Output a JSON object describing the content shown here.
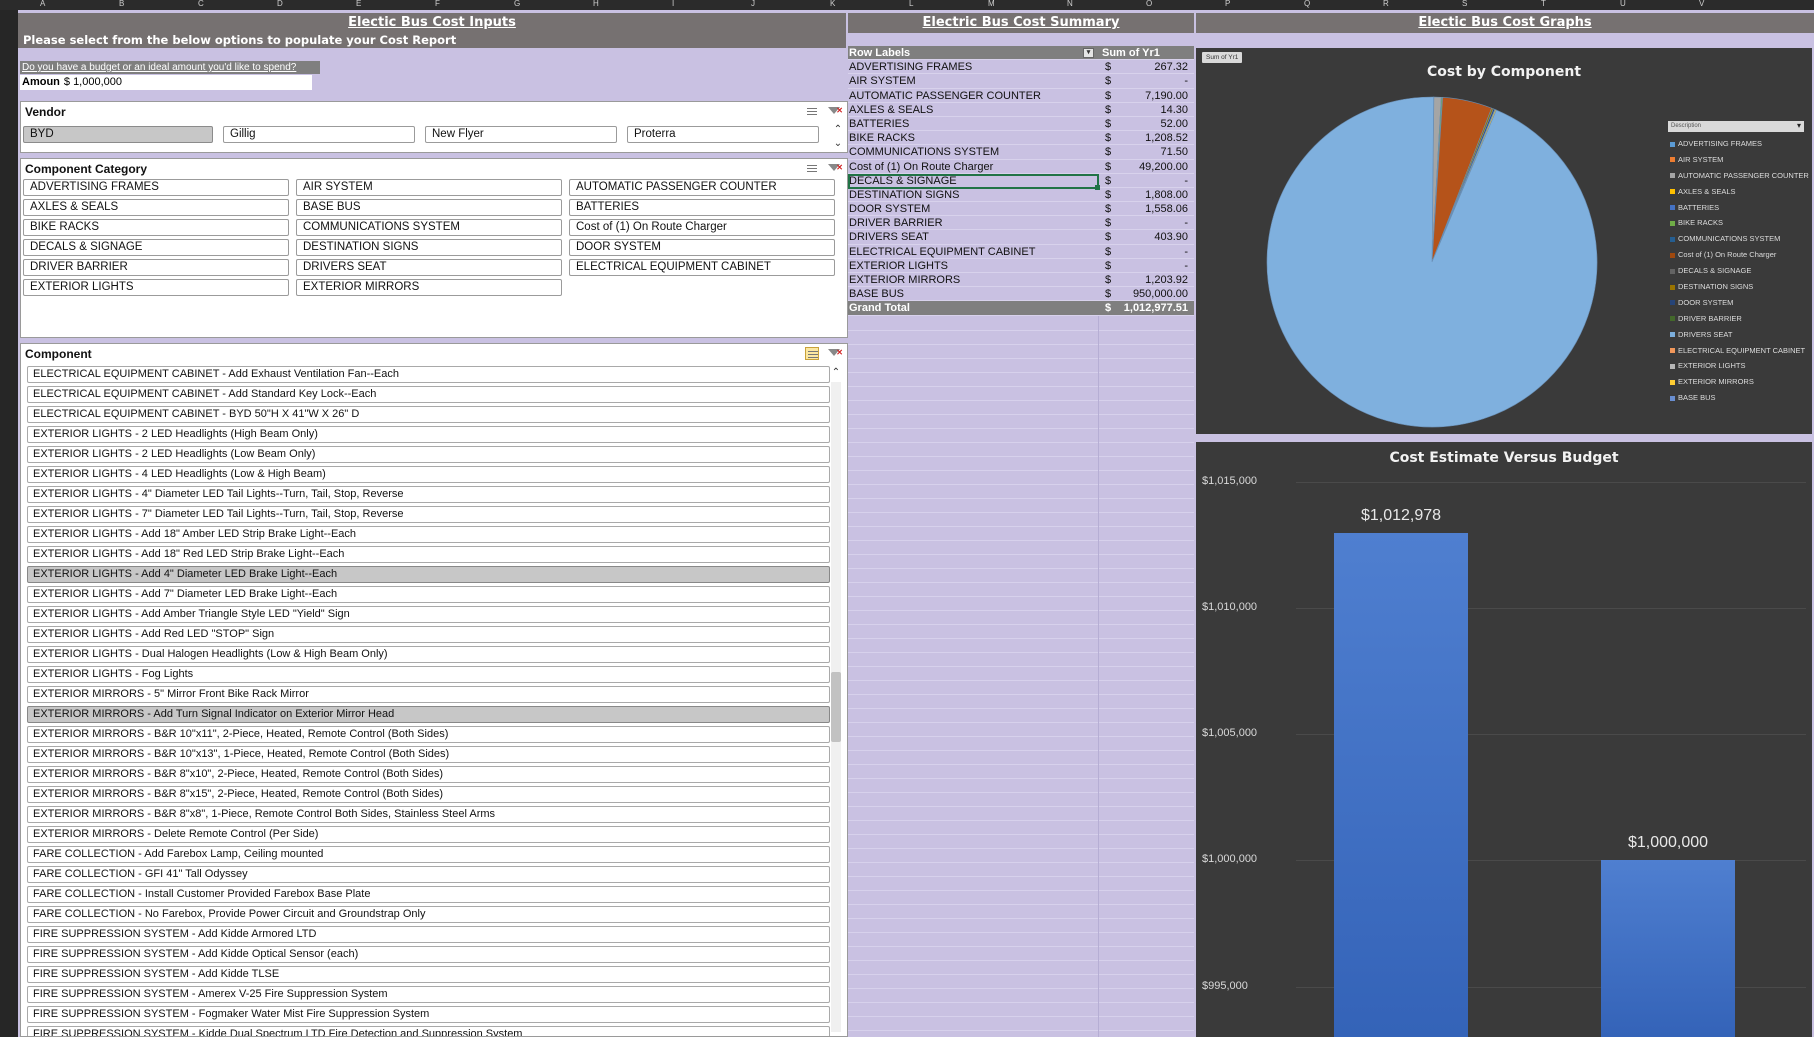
{
  "sheet": {
    "column_letters": [
      "A",
      "B",
      "C",
      "D",
      "E",
      "F",
      "G",
      "H",
      "I",
      "J",
      "K",
      "L",
      "M",
      "N",
      "O",
      "P",
      "Q",
      "R",
      "S",
      "T",
      "U",
      "V"
    ]
  },
  "inputs": {
    "banner": "Electic Bus Cost Inputs",
    "instruction": "Please select from the below options to populate your Cost Report",
    "budget_question": "Do you have a budget or an ideal amount you'd like to spend?",
    "amount_label": "Amoun",
    "amount_value": "$ 1,000,000"
  },
  "vendor_slicer": {
    "title": "Vendor",
    "items": [
      {
        "label": "BYD",
        "selected": true
      },
      {
        "label": "Gillig",
        "selected": false
      },
      {
        "label": "New Flyer",
        "selected": false
      },
      {
        "label": "Proterra",
        "selected": false
      }
    ]
  },
  "category_slicer": {
    "title": "Component Category",
    "items": [
      "ADVERTISING FRAMES",
      "AIR SYSTEM",
      "AUTOMATIC PASSENGER COUNTER",
      "AXLES & SEALS",
      "BASE BUS",
      "BATTERIES",
      "BIKE RACKS",
      "COMMUNICATIONS SYSTEM",
      "Cost of (1) On Route Charger",
      "DECALS & SIGNAGE",
      "DESTINATION SIGNS",
      "DOOR SYSTEM",
      "DRIVER BARRIER",
      "DRIVERS SEAT",
      "ELECTRICAL EQUIPMENT CABINET",
      "EXTERIOR LIGHTS",
      "EXTERIOR MIRRORS"
    ]
  },
  "component_slicer": {
    "title": "Component",
    "items": [
      {
        "label": "ELECTRICAL EQUIPMENT CABINET - Add Exhaust Ventilation Fan--Each",
        "selected": false
      },
      {
        "label": "ELECTRICAL EQUIPMENT CABINET - Add Standard Key Lock--Each",
        "selected": false
      },
      {
        "label": "ELECTRICAL EQUIPMENT CABINET - BYD 50\"H X 41\"W X 26\" D",
        "selected": false
      },
      {
        "label": "EXTERIOR LIGHTS - 2 LED Headlights (High Beam Only)",
        "selected": false
      },
      {
        "label": "EXTERIOR LIGHTS - 2 LED Headlights (Low Beam Only)",
        "selected": false
      },
      {
        "label": "EXTERIOR LIGHTS - 4 LED Headlights (Low & High Beam)",
        "selected": false
      },
      {
        "label": "EXTERIOR LIGHTS - 4\" Diameter LED Tail Lights--Turn, Tail, Stop, Reverse",
        "selected": false
      },
      {
        "label": "EXTERIOR LIGHTS - 7\" Diameter LED Tail Lights--Turn, Tail, Stop, Reverse",
        "selected": false
      },
      {
        "label": "EXTERIOR LIGHTS - Add 18\" Amber LED Strip Brake Light--Each",
        "selected": false
      },
      {
        "label": "EXTERIOR LIGHTS - Add 18\" Red LED Strip Brake Light--Each",
        "selected": false
      },
      {
        "label": "EXTERIOR LIGHTS - Add 4\" Diameter LED Brake Light--Each",
        "selected": true
      },
      {
        "label": "EXTERIOR LIGHTS - Add 7\" Diameter LED Brake Light--Each",
        "selected": false
      },
      {
        "label": "EXTERIOR LIGHTS - Add Amber Triangle Style LED \"Yield\" Sign",
        "selected": false
      },
      {
        "label": "EXTERIOR LIGHTS - Add Red LED \"STOP\" Sign",
        "selected": false
      },
      {
        "label": "EXTERIOR LIGHTS - Dual Halogen Headlights (Low & High Beam Only)",
        "selected": false
      },
      {
        "label": "EXTERIOR LIGHTS - Fog Lights",
        "selected": false
      },
      {
        "label": "EXTERIOR MIRRORS - 5\" Mirror Front Bike Rack Mirror",
        "selected": false
      },
      {
        "label": "EXTERIOR MIRRORS - Add Turn Signal Indicator on Exterior Mirror Head",
        "selected": true
      },
      {
        "label": "EXTERIOR MIRRORS - B&R 10\"x11\", 2-Piece, Heated, Remote Control (Both Sides)",
        "selected": false
      },
      {
        "label": "EXTERIOR MIRRORS - B&R 10\"x13\", 1-Piece, Heated, Remote Control (Both Sides)",
        "selected": false
      },
      {
        "label": "EXTERIOR MIRRORS - B&R 8\"x10\", 2-Piece, Heated, Remote Control (Both Sides)",
        "selected": false
      },
      {
        "label": "EXTERIOR MIRRORS - B&R 8\"x15\", 2-Piece, Heated, Remote Control (Both Sides)",
        "selected": false
      },
      {
        "label": "EXTERIOR MIRRORS - B&R 8\"x8\", 1-Piece, Remote Control Both Sides, Stainless Steel Arms",
        "selected": false
      },
      {
        "label": "EXTERIOR MIRRORS - Delete Remote Control (Per Side)",
        "selected": false
      },
      {
        "label": "FARE COLLECTION  - Add Farebox Lamp, Ceiling mounted",
        "selected": false
      },
      {
        "label": "FARE COLLECTION  - GFI 41\" Tall Odyssey",
        "selected": false
      },
      {
        "label": "FARE COLLECTION  - Install Customer Provided Farebox Base Plate",
        "selected": false
      },
      {
        "label": "FARE COLLECTION  - No Farebox, Provide Power Circuit and Groundstrap Only",
        "selected": false
      },
      {
        "label": "FIRE SUPPRESSION SYSTEM - Add Kidde Armored LTD",
        "selected": false
      },
      {
        "label": "FIRE SUPPRESSION SYSTEM - Add Kidde Optical Sensor (each)",
        "selected": false
      },
      {
        "label": "FIRE SUPPRESSION SYSTEM - Add Kidde TLSE",
        "selected": false
      },
      {
        "label": "FIRE SUPPRESSION SYSTEM - Amerex V-25 Fire Suppression System",
        "selected": false
      },
      {
        "label": "FIRE SUPPRESSION SYSTEM - Fogmaker Water Mist Fire Suppression System",
        "selected": false
      },
      {
        "label": "FIRE SUPPRESSION SYSTEM - Kidde Dual Spectrum LTD Fire Detection and Suppression System",
        "selected": false
      }
    ],
    "scroll_position": 0.5
  },
  "summary": {
    "banner": "Electric Bus Cost Summary",
    "header_label": "Row Labels",
    "header_value": "Sum of Yr1",
    "currency": "$",
    "rows": [
      {
        "label": "ADVERTISING FRAMES",
        "value": "267.32"
      },
      {
        "label": "AIR SYSTEM",
        "value": "-"
      },
      {
        "label": "AUTOMATIC PASSENGER COUNTER",
        "value": "7,190.00"
      },
      {
        "label": "AXLES & SEALS",
        "value": "14.30"
      },
      {
        "label": "BATTERIES",
        "value": "52.00"
      },
      {
        "label": "BIKE RACKS",
        "value": "1,208.52"
      },
      {
        "label": "COMMUNICATIONS SYSTEM",
        "value": "71.50"
      },
      {
        "label": "Cost of (1) On Route Charger",
        "value": "49,200.00"
      },
      {
        "label": "DECALS & SIGNAGE",
        "value": "-"
      },
      {
        "label": "DESTINATION SIGNS",
        "value": "1,808.00"
      },
      {
        "label": "DOOR SYSTEM",
        "value": "1,558.06"
      },
      {
        "label": "DRIVER BARRIER",
        "value": "-"
      },
      {
        "label": "DRIVERS SEAT",
        "value": "403.90"
      },
      {
        "label": "ELECTRICAL EQUIPMENT CABINET",
        "value": "-"
      },
      {
        "label": "EXTERIOR LIGHTS",
        "value": "-"
      },
      {
        "label": "EXTERIOR MIRRORS",
        "value": "1,203.92"
      },
      {
        "label": "BASE BUS",
        "value": "950,000.00"
      }
    ],
    "total_label": "Grand Total",
    "total_value": "1,012,977.51"
  },
  "graphs": {
    "banner": "Electic Bus Cost Graphs",
    "pie_field_button": "Sum of Yr1",
    "legend_dropdown": "Description",
    "legend_colors": [
      "#5b9bd5",
      "#ed7d31",
      "#a5a5a5",
      "#ffc000",
      "#4472c4",
      "#70ad47",
      "#255e91",
      "#9e480e",
      "#636363",
      "#997300",
      "#264478",
      "#43682b",
      "#7cafdd",
      "#f1975a",
      "#b7b7b7",
      "#ffcd33",
      "#698ed0"
    ]
  },
  "chart_data": [
    {
      "type": "pie",
      "title": "Cost by Component",
      "categories": [
        "ADVERTISING FRAMES",
        "AIR SYSTEM",
        "AUTOMATIC PASSENGER COUNTER",
        "AXLES & SEALS",
        "BATTERIES",
        "BIKE RACKS",
        "COMMUNICATIONS SYSTEM",
        "Cost of (1) On Route Charger",
        "DECALS & SIGNAGE",
        "DESTINATION SIGNS",
        "DOOR SYSTEM",
        "DRIVER BARRIER",
        "DRIVERS SEAT",
        "ELECTRICAL EQUIPMENT CABINET",
        "EXTERIOR LIGHTS",
        "EXTERIOR MIRRORS",
        "BASE BUS"
      ],
      "values": [
        267.32,
        0,
        7190,
        14.3,
        52,
        1208.52,
        71.5,
        49200,
        0,
        1808,
        1558.06,
        0,
        403.9,
        0,
        0,
        1203.92,
        950000
      ],
      "legend": "right"
    },
    {
      "type": "bar",
      "title": "Cost Estimate Versus Budget",
      "values": [
        1012977.51,
        1000000
      ],
      "data_labels": [
        "$1,012,978",
        "$1,000,000"
      ],
      "ylim": [
        993000,
        1015000
      ],
      "yticks": [
        "$1,015,000",
        "$1,010,000",
        "$1,005,000",
        "$1,000,000",
        "$995,000"
      ],
      "ytick_values": [
        1015000,
        1010000,
        1005000,
        1000000,
        995000
      ],
      "grid": true
    }
  ]
}
